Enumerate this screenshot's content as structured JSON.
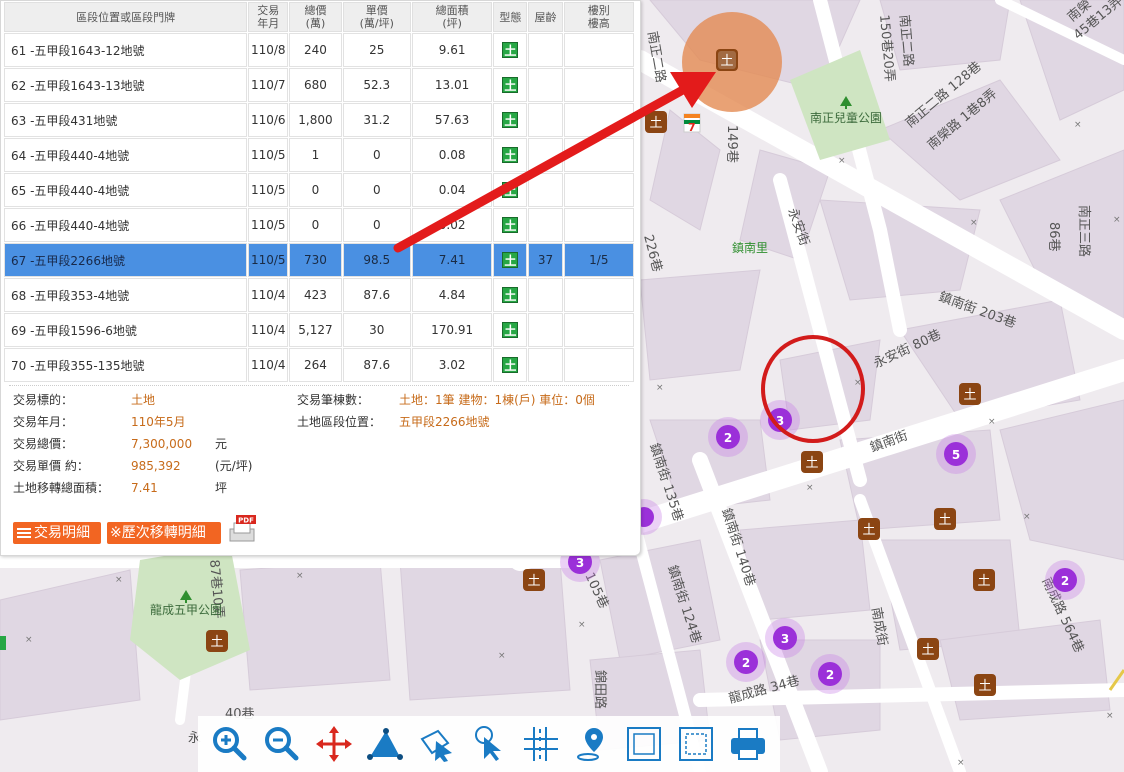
{
  "table": {
    "headers": [
      "區段位置或區段門牌",
      "交易\n年月",
      "總價\n(萬)",
      "單價\n(萬/坪)",
      "總面積\n(坪)",
      "型態",
      "屋齡",
      "樓別\n樓高"
    ],
    "rows": [
      {
        "loc": "61 -五甲段1643-12地號",
        "ym": "110/8",
        "total": "240",
        "unit": "25",
        "area": "9.61",
        "type": "土",
        "age": "",
        "floor": ""
      },
      {
        "loc": "62 -五甲段1643-13地號",
        "ym": "110/7",
        "total": "680",
        "unit": "52.3",
        "area": "13.01",
        "type": "土",
        "age": "",
        "floor": ""
      },
      {
        "loc": "63 -五甲段431地號",
        "ym": "110/6",
        "total": "1,800",
        "unit": "31.2",
        "area": "57.63",
        "type": "土",
        "age": "",
        "floor": ""
      },
      {
        "loc": "64 -五甲段440-4地號",
        "ym": "110/5",
        "total": "1",
        "unit": "0",
        "area": "0.08",
        "type": "土",
        "age": "",
        "floor": ""
      },
      {
        "loc": "65 -五甲段440-4地號",
        "ym": "110/5",
        "total": "0",
        "unit": "0",
        "area": "0.04",
        "type": "土",
        "age": "",
        "floor": ""
      },
      {
        "loc": "66 -五甲段440-4地號",
        "ym": "110/5",
        "total": "0",
        "unit": "0",
        "area": "0.02",
        "type": "土",
        "age": "",
        "floor": ""
      },
      {
        "loc": "67 -五甲段2266地號",
        "ym": "110/5",
        "total": "730",
        "unit": "98.5",
        "area": "7.41",
        "type": "土",
        "age": "37",
        "floor": "1/5"
      },
      {
        "loc": "68 -五甲段353-4地號",
        "ym": "110/4",
        "total": "423",
        "unit": "87.6",
        "area": "4.84",
        "type": "土",
        "age": "",
        "floor": ""
      },
      {
        "loc": "69 -五甲段1596-6地號",
        "ym": "110/4",
        "total": "5,127",
        "unit": "30",
        "area": "170.91",
        "type": "土",
        "age": "",
        "floor": ""
      },
      {
        "loc": "70 -五甲段355-135地號",
        "ym": "110/4",
        "total": "264",
        "unit": "87.6",
        "area": "3.02",
        "type": "土",
        "age": "",
        "floor": ""
      }
    ]
  },
  "detail": {
    "target_label": "交易標的：",
    "target_value": "土地",
    "ym_label": "交易年月：",
    "ym_value": "110年5月",
    "total_label": "交易總價：",
    "total_value": "7,300,000",
    "total_unit": "元",
    "unit_label": "交易單價 約：",
    "unit_value": "985,392",
    "unit_unit": "(元/坪)",
    "area_label": "土地移轉總面積：",
    "area_value": "7.41",
    "area_unit": "坪",
    "count_label": "交易筆棟數：",
    "count_value": "土地：1筆 建物：1棟(戶) 車位：0個",
    "section_label": "土地區段位置：",
    "section_value": "五甲段2266地號"
  },
  "buttons": {
    "detail": "交易明細",
    "history": "※歷次移轉明細",
    "pdf": "PDF"
  },
  "map": {
    "streets": [
      "南正二路",
      "150巷20弄",
      "南正二路 128巷",
      "南榮路 1巷8弄",
      "南榮",
      "45巷13弄",
      "南正二路",
      "149巷",
      "永安街",
      "226巷",
      "鎮南里",
      "南正三路",
      "86巷",
      "鎮南街 203巷",
      "永安街 80巷",
      "鎮南街",
      "鎮南街 135巷",
      "鎮南街 140巷",
      "鎮南街 124巷",
      "105巷",
      "87巷10弄",
      "南成街",
      "龍成路 34巷",
      "南成路 564巷",
      "錦田路",
      "永",
      "40巷"
    ],
    "parks": [
      "南正兒童公園",
      "龍成五甲公園"
    ],
    "clusters": [
      "3",
      "2",
      "5",
      "2",
      "3",
      "2",
      "2",
      "3"
    ],
    "marker_char": "土",
    "seven_eleven": "7"
  },
  "toolbar": [
    "zoom-in-icon",
    "zoom-out-icon",
    "pan-icon",
    "measure-area-icon",
    "select-icon",
    "click-info-icon",
    "road-icon",
    "location-icon",
    "frame-icon",
    "frame-dashed-icon",
    "print-icon"
  ],
  "colors": {
    "selected_row": "#4a90e2",
    "orange_button": "#f26522",
    "value_orange": "#c76b1a",
    "type_green": "#27a745",
    "cluster_purple": "#9b30d9",
    "marker_brown": "#8b4513"
  }
}
